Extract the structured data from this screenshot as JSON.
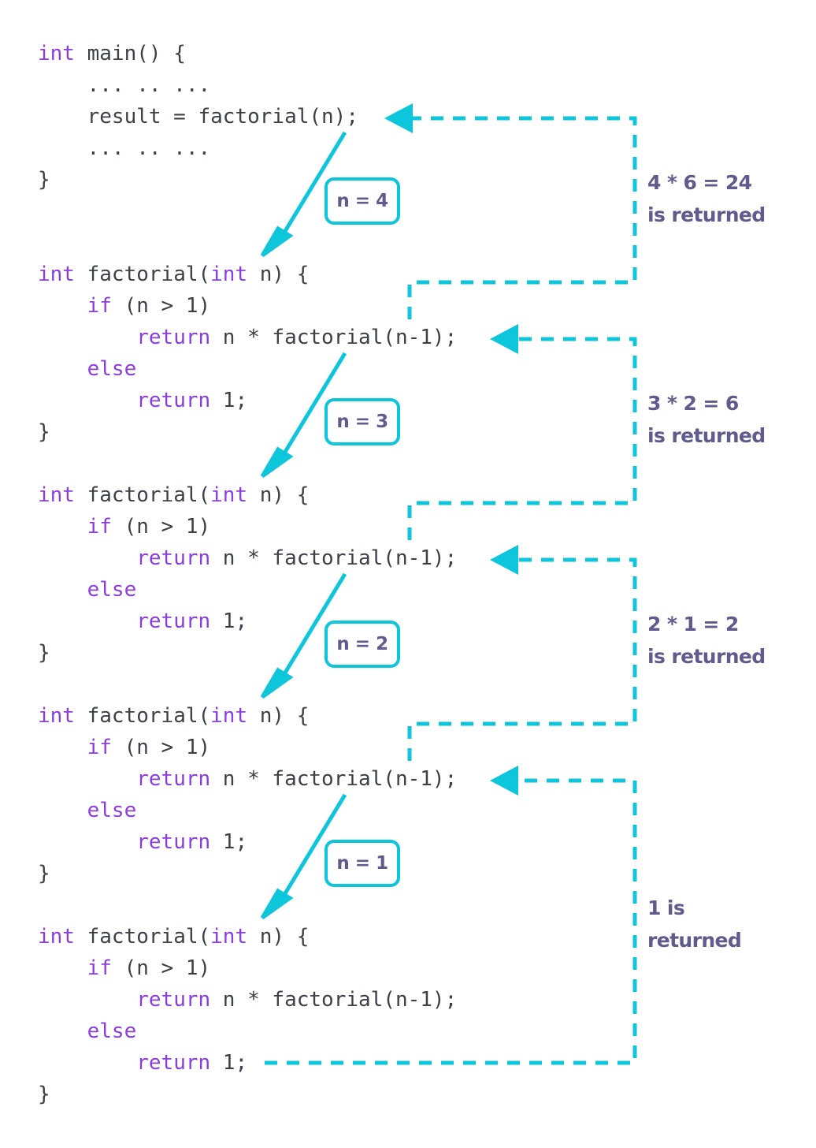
{
  "diagram": {
    "title": "Recursive factorial call/return trace",
    "colors": {
      "accent_cyan": "#0ec6db",
      "keyword_purple": "#8b3ee0",
      "code_gray": "#3c4048",
      "annotation_purple": "#5f5b8c",
      "background": "#ffffff"
    }
  },
  "code_blocks": [
    {
      "id": "main",
      "lines": [
        [
          {
            "t": "int",
            "k": true
          },
          {
            "t": " main() {",
            "k": false
          }
        ],
        [
          {
            "t": "    ... .. ...",
            "k": false
          }
        ],
        [
          {
            "t": "    result = factorial(n);",
            "k": false
          }
        ],
        [
          {
            "t": "    ... .. ...",
            "k": false
          }
        ],
        [
          {
            "t": "}",
            "k": false
          }
        ]
      ]
    },
    {
      "id": "factorial-1",
      "lines": [
        [
          {
            "t": "int",
            "k": true
          },
          {
            "t": " factorial(",
            "k": false
          },
          {
            "t": "int",
            "k": true
          },
          {
            "t": " n) {",
            "k": false
          }
        ],
        [
          {
            "t": "    ",
            "k": false
          },
          {
            "t": "if",
            "k": true
          },
          {
            "t": " (n > 1)",
            "k": false
          }
        ],
        [
          {
            "t": "        ",
            "k": false
          },
          {
            "t": "return",
            "k": true
          },
          {
            "t": " n * factorial(n-1);",
            "k": false
          }
        ],
        [
          {
            "t": "    ",
            "k": false
          },
          {
            "t": "else",
            "k": true
          }
        ],
        [
          {
            "t": "        ",
            "k": false
          },
          {
            "t": "return",
            "k": true
          },
          {
            "t": " 1;",
            "k": false
          }
        ],
        [
          {
            "t": "}",
            "k": false
          }
        ]
      ]
    },
    {
      "id": "factorial-2",
      "lines": [
        [
          {
            "t": "int",
            "k": true
          },
          {
            "t": " factorial(",
            "k": false
          },
          {
            "t": "int",
            "k": true
          },
          {
            "t": " n) {",
            "k": false
          }
        ],
        [
          {
            "t": "    ",
            "k": false
          },
          {
            "t": "if",
            "k": true
          },
          {
            "t": " (n > 1)",
            "k": false
          }
        ],
        [
          {
            "t": "        ",
            "k": false
          },
          {
            "t": "return",
            "k": true
          },
          {
            "t": " n * factorial(n-1);",
            "k": false
          }
        ],
        [
          {
            "t": "    ",
            "k": false
          },
          {
            "t": "else",
            "k": true
          }
        ],
        [
          {
            "t": "        ",
            "k": false
          },
          {
            "t": "return",
            "k": true
          },
          {
            "t": " 1;",
            "k": false
          }
        ],
        [
          {
            "t": "}",
            "k": false
          }
        ]
      ]
    },
    {
      "id": "factorial-3",
      "lines": [
        [
          {
            "t": "int",
            "k": true
          },
          {
            "t": " factorial(",
            "k": false
          },
          {
            "t": "int",
            "k": true
          },
          {
            "t": " n) {",
            "k": false
          }
        ],
        [
          {
            "t": "    ",
            "k": false
          },
          {
            "t": "if",
            "k": true
          },
          {
            "t": " (n > 1)",
            "k": false
          }
        ],
        [
          {
            "t": "        ",
            "k": false
          },
          {
            "t": "return",
            "k": true
          },
          {
            "t": " n * factorial(n-1);",
            "k": false
          }
        ],
        [
          {
            "t": "    ",
            "k": false
          },
          {
            "t": "else",
            "k": true
          }
        ],
        [
          {
            "t": "        ",
            "k": false
          },
          {
            "t": "return",
            "k": true
          },
          {
            "t": " 1;",
            "k": false
          }
        ],
        [
          {
            "t": "}",
            "k": false
          }
        ]
      ]
    },
    {
      "id": "factorial-4",
      "lines": [
        [
          {
            "t": "int",
            "k": true
          },
          {
            "t": " factorial(",
            "k": false
          },
          {
            "t": "int",
            "k": true
          },
          {
            "t": " n) {",
            "k": false
          }
        ],
        [
          {
            "t": "    ",
            "k": false
          },
          {
            "t": "if",
            "k": true
          },
          {
            "t": " (n > 1)",
            "k": false
          }
        ],
        [
          {
            "t": "        ",
            "k": false
          },
          {
            "t": "return",
            "k": true
          },
          {
            "t": " n * factorial(n-1);",
            "k": false
          }
        ],
        [
          {
            "t": "    ",
            "k": false
          },
          {
            "t": "else",
            "k": true
          }
        ],
        [
          {
            "t": "        ",
            "k": false
          },
          {
            "t": "return",
            "k": true
          },
          {
            "t": " 1;",
            "k": false
          }
        ],
        [
          {
            "t": "}",
            "k": false
          }
        ]
      ]
    }
  ],
  "call_labels": [
    {
      "id": "n4",
      "text": "n = 4"
    },
    {
      "id": "n3",
      "text": "n = 3"
    },
    {
      "id": "n2",
      "text": "n = 2"
    },
    {
      "id": "n1",
      "text": "n = 1"
    }
  ],
  "return_notes": [
    {
      "id": "ret24",
      "line1": "4 * 6 = 24",
      "line2": "is returned"
    },
    {
      "id": "ret6",
      "line1": "3 * 2 = 6",
      "line2": "is returned"
    },
    {
      "id": "ret2",
      "line1": "2 * 1 = 2",
      "line2": "is returned"
    },
    {
      "id": "ret1",
      "line1": "1 is",
      "line2": "returned"
    }
  ]
}
